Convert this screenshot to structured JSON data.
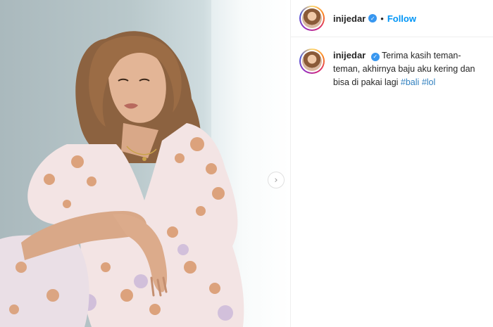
{
  "post": {
    "username": "inijedar",
    "follow_label": "Follow",
    "separator": "•",
    "caption_text": "Terima kasih teman-teman, akhirnya baju aku kering dan bisa di pakai lagi",
    "hashtags": [
      "#bali",
      "#lol"
    ]
  },
  "icons": {
    "verified": "verified-badge-icon",
    "next": "chevron-right-icon"
  },
  "colors": {
    "accent": "#0095f6",
    "verified": "#3897f0",
    "hashtag": "#2f7fbf"
  }
}
